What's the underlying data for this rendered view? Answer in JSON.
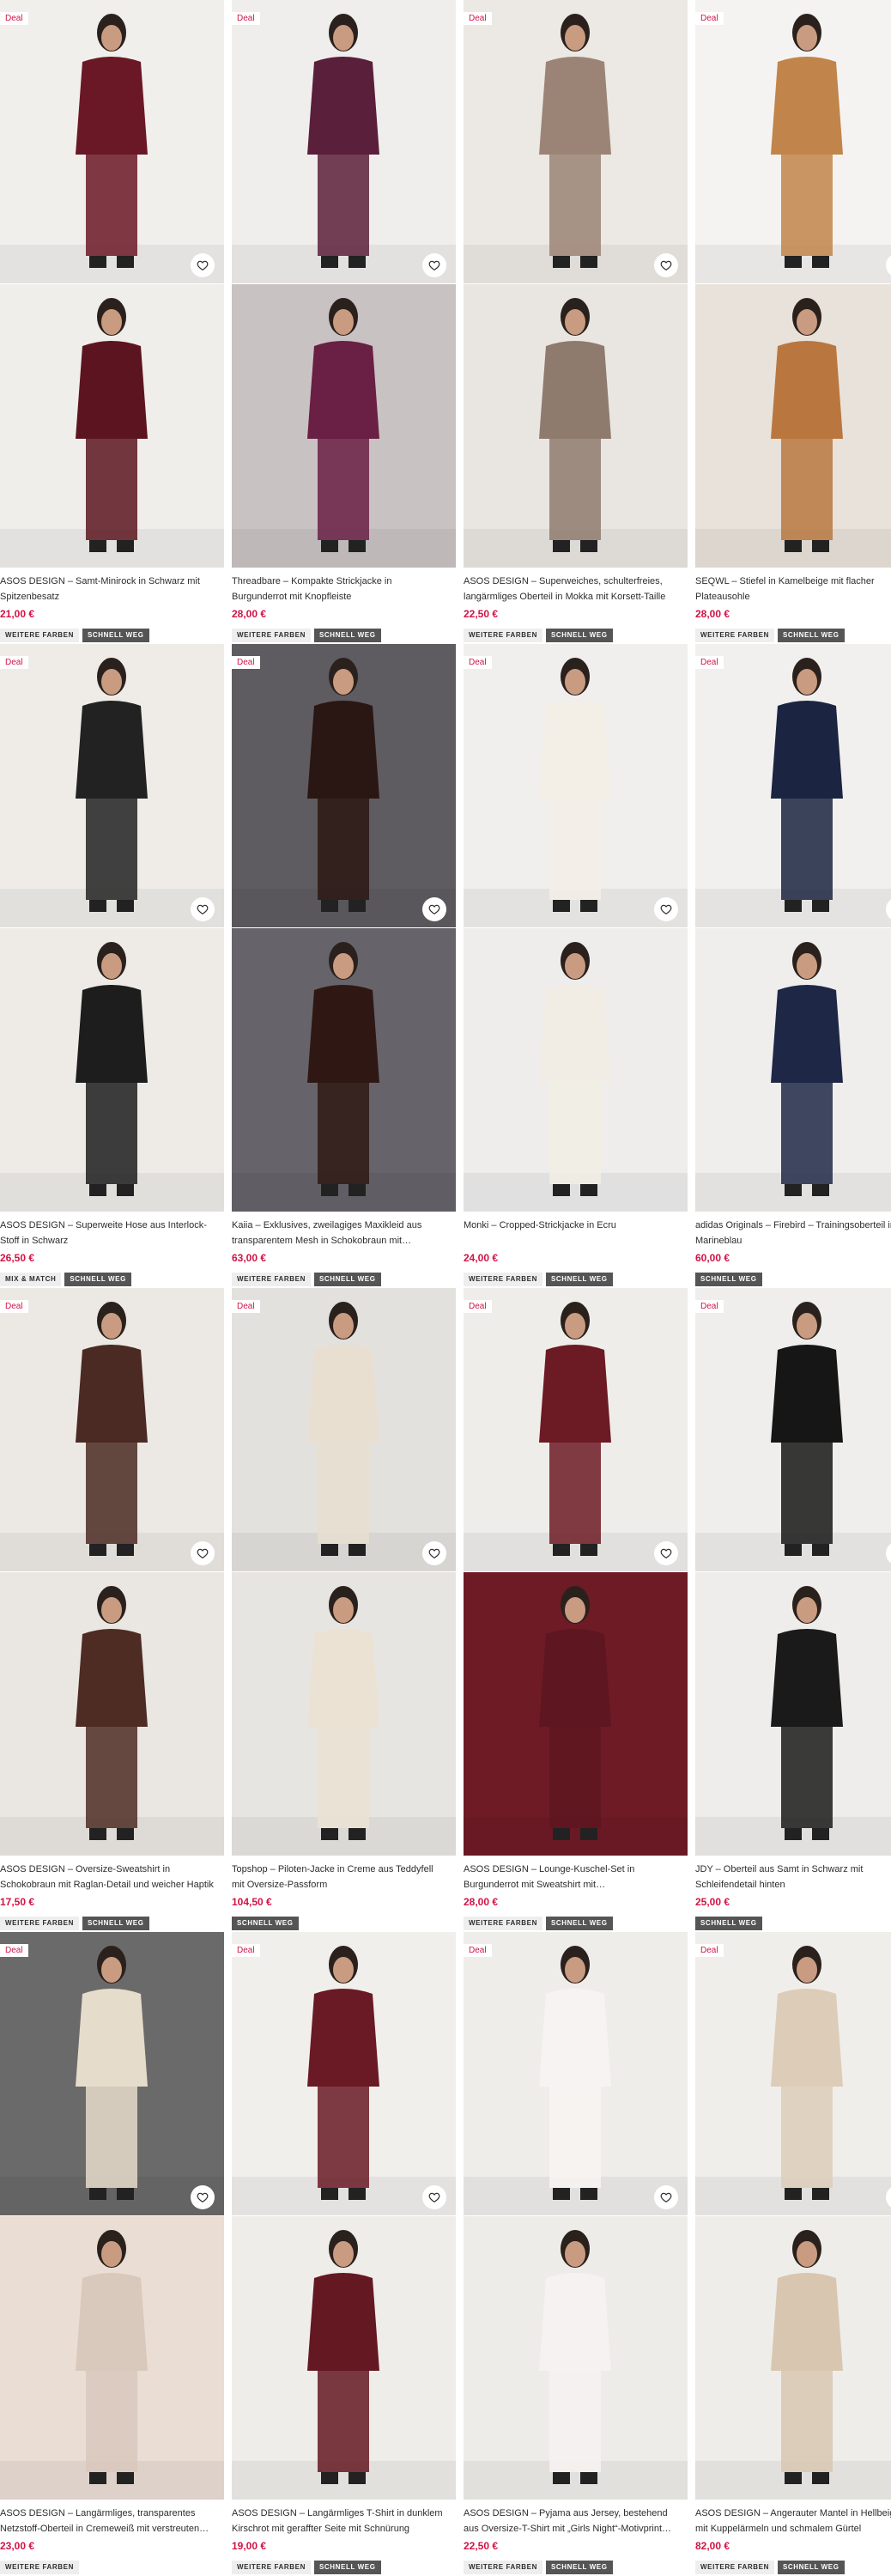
{
  "ui": {
    "deal_color": "#d01345",
    "heart_icon": "heart-icon"
  },
  "products": [
    {
      "deal": "Deal",
      "title": "ASOS DESIGN – Samt-Minirock in Schwarz mit Spitzenbesatz",
      "price": "21,00 €",
      "badges": [
        "WEITERE FARBEN",
        "SCHNELL WEG"
      ],
      "bg1": "#f1efec",
      "fig1": "#6b1826",
      "bg2": "#f0eeeb",
      "fig2": "#5c1520"
    },
    {
      "deal": "Deal",
      "title": "Threadbare – Kompakte Strickjacke in Burgunderrot mit Knopfleiste",
      "price": "28,00 €",
      "badges": [
        "WEITERE FARBEN",
        "SCHNELL WEG"
      ],
      "bg1": "#efeeec",
      "fig1": "#5a1f3a",
      "bg2": "#c9c2c2",
      "fig2": "#6a1f44"
    },
    {
      "deal": "Deal",
      "title": "ASOS DESIGN – Superweiches, schulterfreies, langärmliges Oberteil in Mokka mit Korsett-Taille",
      "price": "22,50 €",
      "badges": [
        "WEITERE FARBEN",
        "SCHNELL WEG"
      ],
      "bg1": "#ece8e3",
      "fig1": "#9b8476",
      "bg2": "#e9e6e2",
      "fig2": "#8f7a6e"
    },
    {
      "deal": "Deal",
      "title": "SEQWL – Stiefel in Kamelbeige mit flacher Plateausohle",
      "price": "28,00 €",
      "badges": [
        "WEITERE FARBEN",
        "SCHNELL WEG"
      ],
      "bg1": "#f4f3f1",
      "fig1": "#c1844a",
      "bg2": "#e8e2da",
      "fig2": "#b9773f"
    },
    {
      "deal": "Deal",
      "title": "ASOS DESIGN – Superweite Hose aus Interlock-Stoff in Schwarz",
      "price": "26,50 €",
      "badges": [
        "MIX & MATCH",
        "SCHNELL WEG"
      ],
      "bg1": "#efece8",
      "fig1": "#222222",
      "bg2": "#eeebe7",
      "fig2": "#1d1d1d"
    },
    {
      "deal": "Deal",
      "title": "Kaiia – Exklusives, zweilagiges Maxikleid aus transparentem Mesh in Schokobraun mit Raffungen",
      "price": "63,00 €",
      "badges": [
        "WEITERE FARBEN",
        "SCHNELL WEG"
      ],
      "bg1": "#5e5c61",
      "fig1": "#2a1612",
      "bg2": "#66646a",
      "fig2": "#2f1813"
    },
    {
      "deal": "Deal",
      "title": "Monki – Cropped-Strickjacke in Ecru",
      "price": "24,00 €",
      "badges": [
        "WEITERE FARBEN",
        "SCHNELL WEG"
      ],
      "bg1": "#f0efee",
      "fig1": "#f3efe6",
      "bg2": "#eeedec",
      "fig2": "#f1ede4"
    },
    {
      "deal": "Deal",
      "title": "adidas Originals – Firebird – Trainingsoberteil in Marineblau",
      "price": "60,00 €",
      "badges": [
        "SCHNELL WEG"
      ],
      "bg1": "#f1f0ef",
      "fig1": "#1b2541",
      "bg2": "#efeeed",
      "fig2": "#1e2846"
    },
    {
      "deal": "Deal",
      "title": "ASOS DESIGN – Oversize-Sweatshirt in Schokobraun mit Raglan-Detail und weicher Haptik",
      "price": "17,50 €",
      "badges": [
        "WEITERE FARBEN",
        "SCHNELL WEG"
      ],
      "bg1": "#ece9e5",
      "fig1": "#4a2a22",
      "bg2": "#eae7e3",
      "fig2": "#4e2c23"
    },
    {
      "deal": "Deal",
      "title": "Topshop – Piloten-Jacke in Creme aus Teddyfell mit Oversize-Passform",
      "price": "104,50 €",
      "badges": [
        "SCHNELL WEG"
      ],
      "bg1": "#e3e1de",
      "fig1": "#e8dfd0",
      "bg2": "#e7e5e2",
      "fig2": "#ebe2d3"
    },
    {
      "deal": "Deal",
      "title": "ASOS DESIGN – Lounge-Kuschel-Set in Burgunderrot mit Sweatshirt mit Rundhalsausschnitt und Hose",
      "price": "28,00 €",
      "badges": [
        "WEITERE FARBEN",
        "SCHNELL WEG"
      ],
      "bg1": "#efedea",
      "fig1": "#6c1a24",
      "bg2": "#6e1b25",
      "fig2": "#5e1620"
    },
    {
      "deal": "Deal",
      "title": "JDY – Oberteil aus Samt in Schwarz mit Schleifendetail hinten",
      "price": "25,00 €",
      "badges": [
        "SCHNELL WEG"
      ],
      "bg1": "#efeeec",
      "fig1": "#161616",
      "bg2": "#eeedeb",
      "fig2": "#1a1a1a"
    },
    {
      "deal": "Deal",
      "title": "ASOS DESIGN – Langärmliges, transparentes Netzstoff-Oberteil in Cremeweiß mit verstreuten Schmucksteinen",
      "price": "23,00 €",
      "badges": [
        "WEITERE FARBEN"
      ],
      "bg1": "#6b6a6a",
      "fig1": "#e6dccb",
      "bg2": "#e9ddd4",
      "fig2": "#d9c8bc"
    },
    {
      "deal": "Deal",
      "title": "ASOS DESIGN – Langärmliges T-Shirt in dunklem Kirschrot mit geraffter Seite mit Schnürung",
      "price": "19,00 €",
      "badges": [
        "WEITERE FARBEN",
        "SCHNELL WEG"
      ],
      "bg1": "#f1efec",
      "fig1": "#6a1a24",
      "bg2": "#efede9",
      "fig2": "#641822"
    },
    {
      "deal": "Deal",
      "title": "ASOS DESIGN – Pyjama aus Jersey, bestehend aus Oversize-T-Shirt mit „Girls Night“-Motivprint und Hose",
      "price": "22,50 €",
      "badges": [
        "WEITERE FARBEN",
        "SCHNELL WEG"
      ],
      "bg1": "#efedea",
      "fig1": "#f7f3f2",
      "bg2": "#eeece9",
      "fig2": "#f6f2f1"
    },
    {
      "deal": "Deal",
      "title": "ASOS DESIGN – Angerauter Mantel in Hellbeige mit Kuppelärmeln und schmalem Gürtel",
      "price": "82,00 €",
      "badges": [
        "WEITERE FARBEN",
        "SCHNELL WEG"
      ],
      "bg1": "#f0eeeb",
      "fig1": "#ddccb8",
      "bg2": "#efede9",
      "fig2": "#d8c6b1"
    }
  ]
}
